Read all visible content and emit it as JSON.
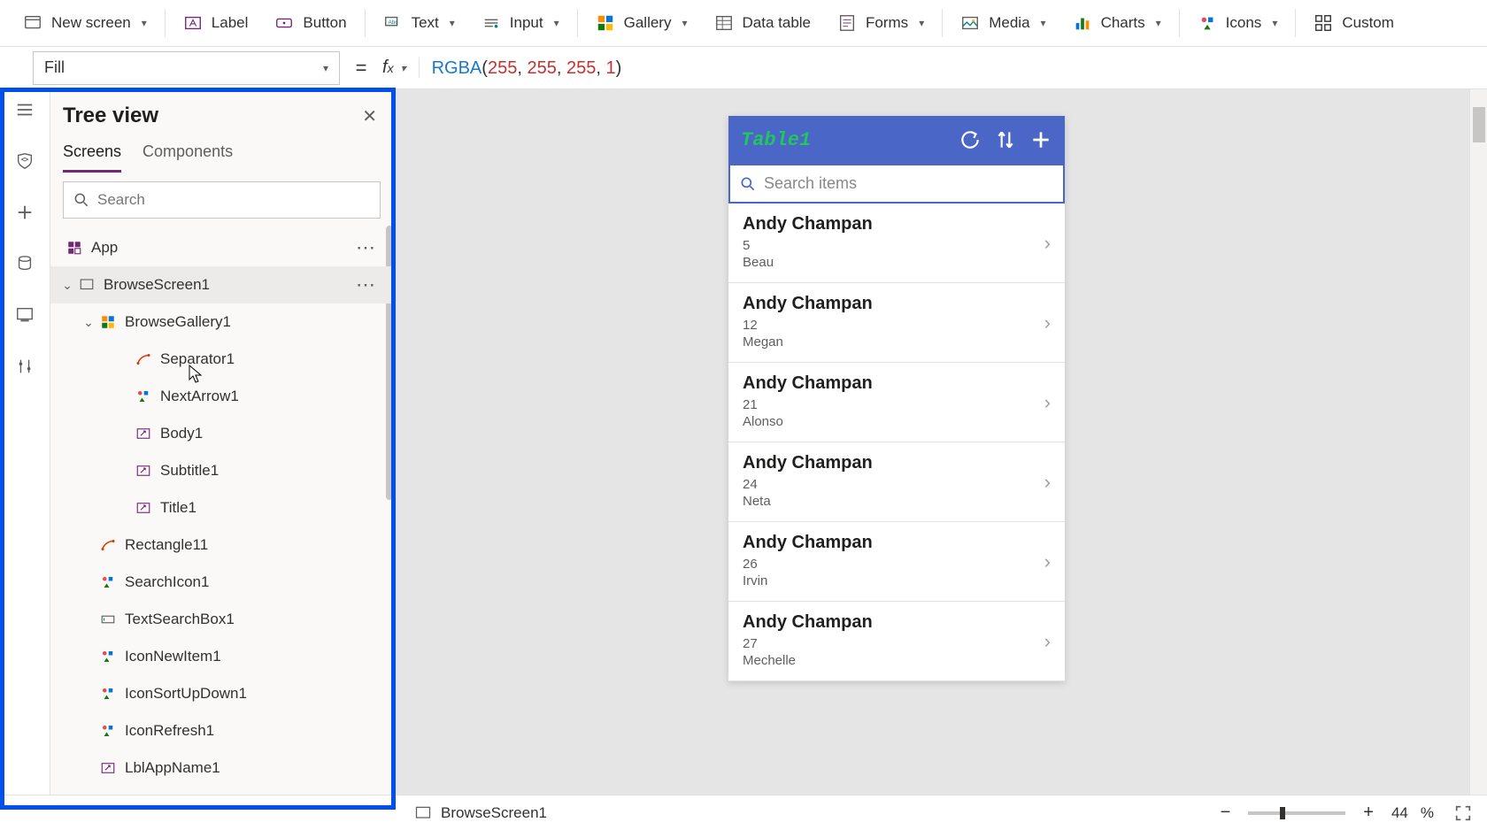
{
  "toolbar": {
    "new_screen": "New screen",
    "label": "Label",
    "button": "Button",
    "text": "Text",
    "input": "Input",
    "gallery": "Gallery",
    "data_table": "Data table",
    "forms": "Forms",
    "media": "Media",
    "charts": "Charts",
    "icons": "Icons",
    "custom": "Custom"
  },
  "prop": {
    "selected": "Fill",
    "formula_fn": "RGBA",
    "formula_args": [
      "255",
      "255",
      "255",
      "1"
    ]
  },
  "tree": {
    "title": "Tree view",
    "tabs": {
      "screens": "Screens",
      "components": "Components"
    },
    "search_placeholder": "Search",
    "items": [
      {
        "label": "App",
        "icon": "app",
        "i": 0,
        "dots": true
      },
      {
        "label": "BrowseScreen1",
        "icon": "screen",
        "i": 1,
        "dots": true,
        "exp": "d"
      },
      {
        "label": "BrowseGallery1",
        "icon": "gallery",
        "i": 2,
        "exp": "d"
      },
      {
        "label": "Separator1",
        "icon": "shape",
        "i": 3
      },
      {
        "label": "NextArrow1",
        "icon": "icon",
        "i": 3
      },
      {
        "label": "Body1",
        "icon": "label",
        "i": 3
      },
      {
        "label": "Subtitle1",
        "icon": "label",
        "i": 3
      },
      {
        "label": "Title1",
        "icon": "label",
        "i": 3
      },
      {
        "label": "Rectangle11",
        "icon": "shape",
        "i": 2
      },
      {
        "label": "SearchIcon1",
        "icon": "icon",
        "i": 2
      },
      {
        "label": "TextSearchBox1",
        "icon": "textbox",
        "i": 2
      },
      {
        "label": "IconNewItem1",
        "icon": "icon",
        "i": 2
      },
      {
        "label": "IconSortUpDown1",
        "icon": "icon",
        "i": 2
      },
      {
        "label": "IconRefresh1",
        "icon": "icon",
        "i": 2
      },
      {
        "label": "LblAppName1",
        "icon": "label",
        "i": 2
      }
    ]
  },
  "phone": {
    "title": "Table1",
    "search_ph": "Search items",
    "items": [
      {
        "title": "Andy Champan",
        "num": "5",
        "sub": "Beau"
      },
      {
        "title": "Andy Champan",
        "num": "12",
        "sub": "Megan"
      },
      {
        "title": "Andy Champan",
        "num": "21",
        "sub": "Alonso"
      },
      {
        "title": "Andy Champan",
        "num": "24",
        "sub": "Neta"
      },
      {
        "title": "Andy Champan",
        "num": "26",
        "sub": "Irvin"
      },
      {
        "title": "Andy Champan",
        "num": "27",
        "sub": "Mechelle"
      }
    ]
  },
  "status": {
    "screen": "BrowseScreen1",
    "zoom": "44",
    "pct": "%"
  }
}
